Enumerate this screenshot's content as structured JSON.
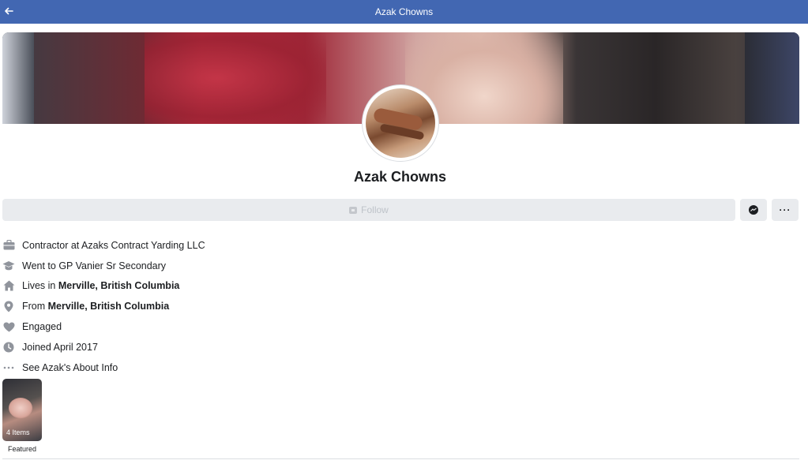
{
  "header": {
    "title": "Azak Chowns"
  },
  "profile": {
    "name": "Azak Chowns"
  },
  "actions": {
    "follow_label": "Follow"
  },
  "intro": [
    {
      "prefix": "Contractor at Azaks Contract Yarding LLC",
      "bold": "",
      "icon": "briefcase-icon"
    },
    {
      "prefix": "Went to GP Vanier Sr Secondary",
      "bold": "",
      "icon": "graduation-cap-icon"
    },
    {
      "prefix": "Lives in ",
      "bold": "Merville, British Columbia",
      "icon": "home-icon"
    },
    {
      "prefix": "From ",
      "bold": "Merville, British Columbia",
      "icon": "location-pin-icon"
    },
    {
      "prefix": "Engaged",
      "bold": "",
      "icon": "heart-icon"
    },
    {
      "prefix": "Joined April 2017",
      "bold": "",
      "icon": "clock-icon"
    },
    {
      "prefix": "See Azak's About Info",
      "bold": "",
      "icon": "ellipsis-icon"
    }
  ],
  "featured": {
    "count_label": "4 Items",
    "label": "Featured"
  },
  "colors": {
    "header_bg": "#4267b2",
    "button_bg": "#e9ebee",
    "icon_gray": "#90949c"
  }
}
